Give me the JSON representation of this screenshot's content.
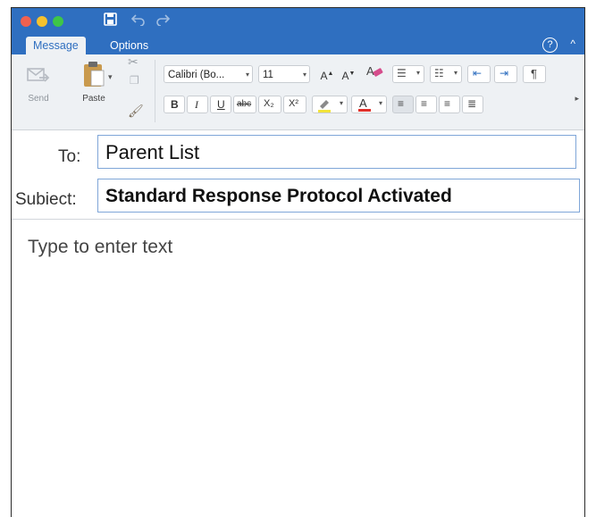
{
  "toolbar": {
    "save_icon": "save-icon",
    "undo_icon": "undo-icon",
    "redo_icon": "redo-icon"
  },
  "tabs": [
    {
      "label": "Message",
      "active": true
    },
    {
      "label": "Options",
      "active": false
    }
  ],
  "ribbon": {
    "send_label": "Send",
    "paste_label": "Paste",
    "font_name": "Calibri (Bo...",
    "font_size": "11",
    "bold": "B",
    "italic": "I",
    "underline": "U",
    "strike": "abc",
    "subscript": "X₂",
    "superscript": "X²"
  },
  "compose": {
    "to_label": "To:",
    "to_value": "Parent List",
    "subject_label": "Subiect:",
    "subject_value": "Standard Response Protocol Activated",
    "body_placeholder": "Type to enter text"
  },
  "colors": {
    "accent": "#2f6fc0",
    "ribbon_bg": "#eef1f4",
    "field_border": "#7fa6d8"
  }
}
